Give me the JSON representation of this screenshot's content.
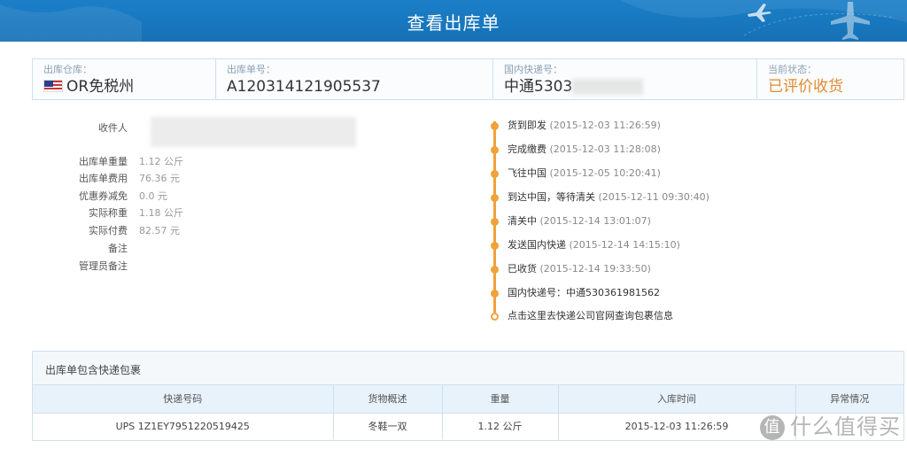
{
  "header": {
    "title": "查看出库单"
  },
  "info_bar": {
    "warehouse": {
      "caption": "出库仓库：",
      "value": "OR免税州"
    },
    "order_no": {
      "caption": "出库单号：",
      "value": "A120314121905537"
    },
    "domestic_tracking": {
      "caption": "国内快递号：",
      "value": "中通5303"
    },
    "status": {
      "caption": "当前状态：",
      "value": "已评价收货"
    }
  },
  "details": [
    {
      "label": "收件人",
      "value": ""
    },
    {
      "label": "出库单重量",
      "value": "1.12 公斤"
    },
    {
      "label": "出库单费用",
      "value": "76.36 元"
    },
    {
      "label": "优惠券减免",
      "value": "0.0 元"
    },
    {
      "label": "实际称重",
      "value": "1.18 公斤"
    },
    {
      "label": "实际付费",
      "value": "82.57 元"
    },
    {
      "label": "备注",
      "value": ""
    },
    {
      "label": "管理员备注",
      "value": ""
    }
  ],
  "timeline": [
    {
      "text": "货到即发",
      "time": "(2015-12-03 11:26:59)"
    },
    {
      "text": "完成缴费",
      "time": "(2015-12-03 11:28:08)"
    },
    {
      "text": "飞往中国",
      "time": "(2015-12-05 10:20:41)"
    },
    {
      "text": "到达中国，等待清关",
      "time": "(2015-12-11 09:30:40)"
    },
    {
      "text": "清关中",
      "time": "(2015-12-14 13:01:07)"
    },
    {
      "text": "发送国内快递",
      "time": "(2015-12-14 14:15:10)"
    },
    {
      "text": "已收货",
      "time": "(2015-12-14 19:33:50)"
    },
    {
      "text": "国内快递号：中通530361981562",
      "time": ""
    },
    {
      "text": "点击这里去快递公司官网查询包裹信息",
      "time": ""
    }
  ],
  "packages": {
    "title": "出库单包含快递包裹",
    "columns": [
      "快递号码",
      "货物概述",
      "重量",
      "入库时间",
      "异常情况"
    ],
    "rows": [
      [
        "UPS 1Z1EY7951220519425",
        "冬鞋一双",
        "1.12 公斤",
        "2015-12-03 11:26:59",
        ""
      ]
    ]
  },
  "watermark": {
    "badge": "值",
    "text": "什么值得买"
  },
  "colors": {
    "header_blue": "#1b7fc8",
    "timeline_orange": "#f0a23a",
    "status_orange": "#e08a2e"
  }
}
